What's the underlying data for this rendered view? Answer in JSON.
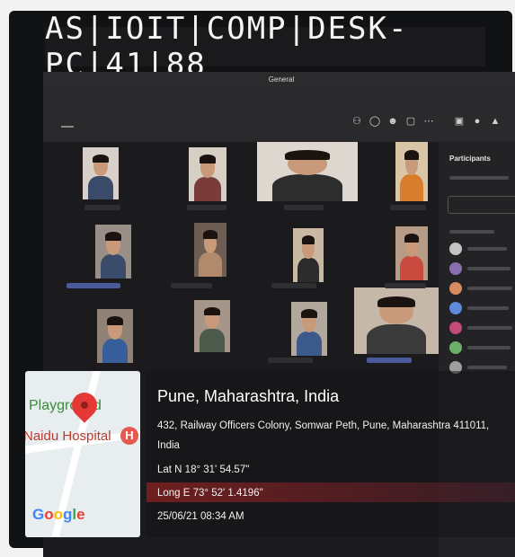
{
  "monitor_sticker": "AS|IOIT|COMP|DESK-PC|41|88",
  "meeting": {
    "window_title": "General",
    "panel_title": "Participants"
  },
  "geotag": {
    "location": "Pune, Maharashtra, India",
    "address": "432, Railway Officers Colony, Somwar Peth, Pune, Maharashtra 411011, India",
    "lat": "Lat N 18° 31' 54.57\"",
    "long": "Long E 73° 52' 1.4196\"",
    "datetime": "25/06/21 08:34 AM",
    "map_labels": {
      "place1": "Playground",
      "place2": "Naidu Hospital",
      "hospital_icon": "H"
    },
    "map_brand": [
      "G",
      "o",
      "o",
      "g",
      "l",
      "e"
    ]
  },
  "colors": {
    "pin": "#e53935",
    "overlay_band": "#aa2323"
  }
}
